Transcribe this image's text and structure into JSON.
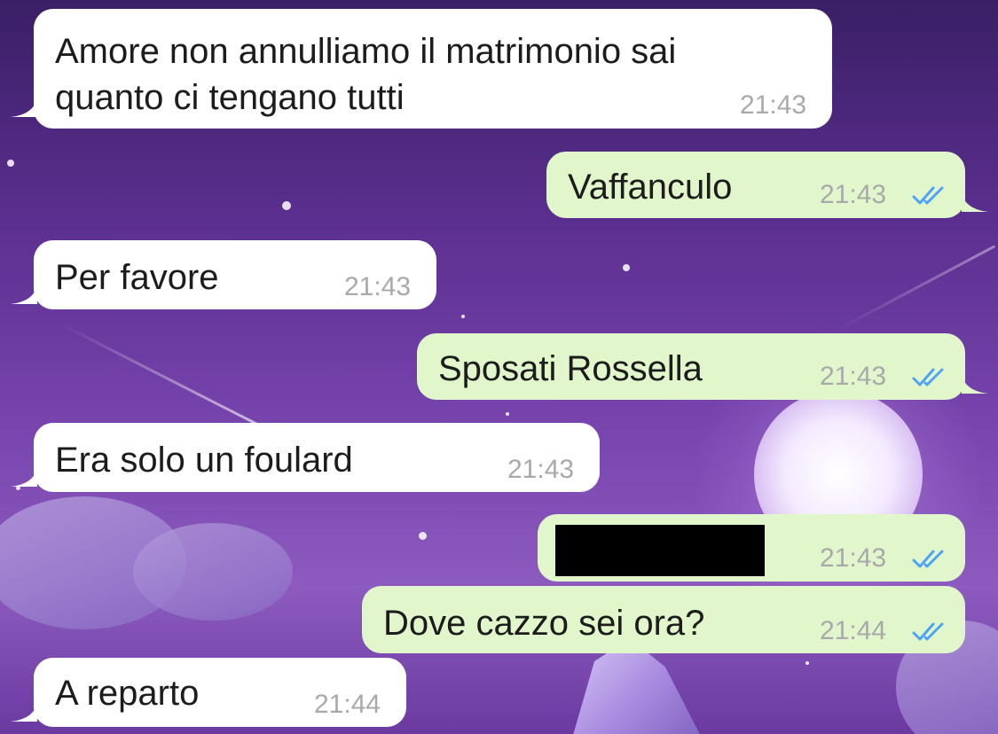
{
  "messages": [
    {
      "direction": "incoming",
      "lines": [
        "Amore non annulliamo il matrimonio sai",
        "quanto ci tengano tutti"
      ],
      "time": "21:43"
    },
    {
      "direction": "outgoing",
      "text": "Vaffanculo",
      "time": "21:43",
      "status": "read"
    },
    {
      "direction": "incoming",
      "text": "Per favore",
      "time": "21:43"
    },
    {
      "direction": "outgoing",
      "text": "Sposati Rossella",
      "time": "21:43",
      "status": "read"
    },
    {
      "direction": "incoming",
      "text": "Era solo un foulard",
      "time": "21:43"
    },
    {
      "direction": "outgoing",
      "text": "",
      "redacted": true,
      "time": "21:43",
      "status": "read"
    },
    {
      "direction": "outgoing",
      "text": "Dove cazzo sei ora?",
      "time": "21:44",
      "status": "read"
    },
    {
      "direction": "incoming",
      "text": "A reparto",
      "time": "21:44"
    }
  ],
  "icons": {
    "read_receipt": "double-check-icon",
    "tick_color": "#4fa3f7"
  },
  "colors": {
    "incoming_bubble": "#ffffff",
    "outgoing_bubble": "#e1f7cb"
  }
}
